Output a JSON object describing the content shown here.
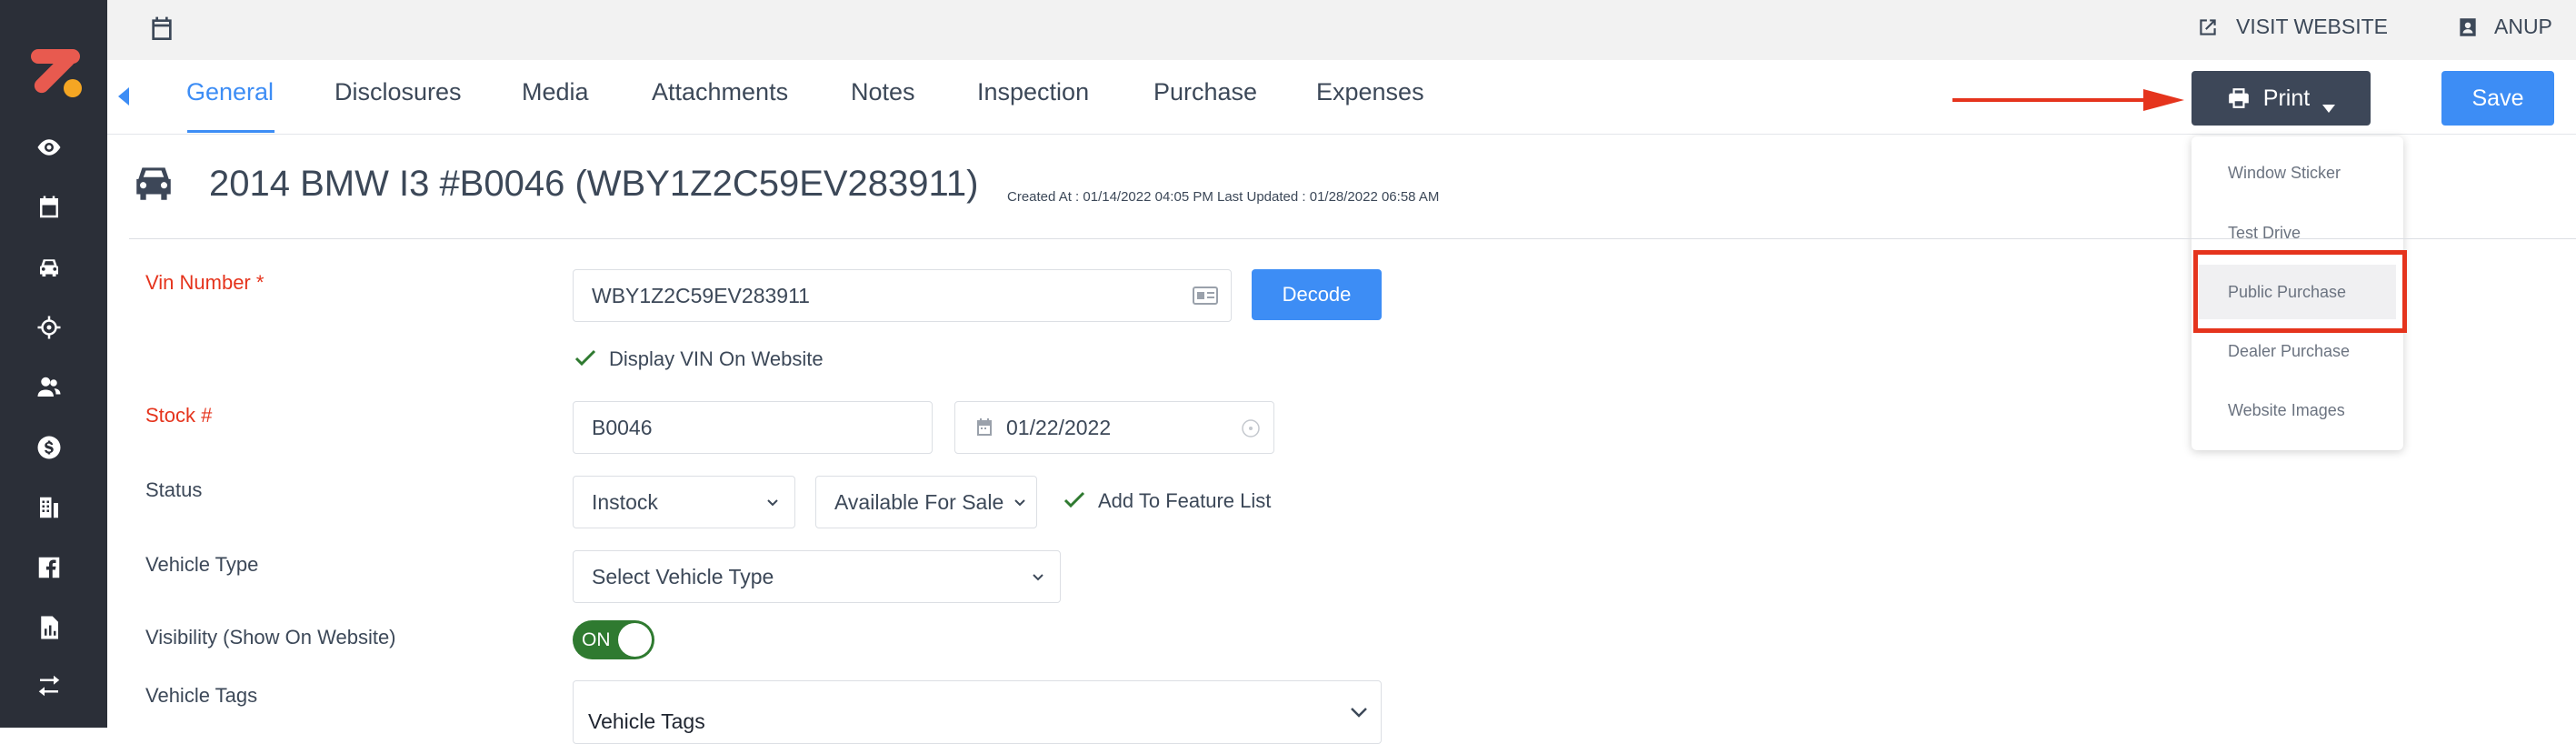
{
  "topbar": {
    "visit_website": "VISIT WEBSITE",
    "user_name": "ANUP"
  },
  "tabs": [
    {
      "label": "General",
      "active": true
    },
    {
      "label": "Disclosures"
    },
    {
      "label": "Media"
    },
    {
      "label": "Attachments"
    },
    {
      "label": "Notes"
    },
    {
      "label": "Inspection"
    },
    {
      "label": "Purchase"
    },
    {
      "label": "Expenses"
    }
  ],
  "toolbar": {
    "print_label": "Print",
    "save_label": "Save"
  },
  "print_menu": {
    "items": [
      "Window Sticker",
      "Test Drive",
      "Public Purchase",
      "Dealer Purchase",
      "Website Images"
    ],
    "highlighted": "Public Purchase"
  },
  "vehicle": {
    "title": "2014 BMW I3 #B0046 (WBY1Z2C59EV283911)",
    "meta": "Created At : 01/14/2022 04:05 PM Last Updated : 01/28/2022 06:58 AM"
  },
  "form": {
    "vin_label": "Vin Number *",
    "vin_value": "WBY1Z2C59EV283911",
    "decode_label": "Decode",
    "display_vin_label": "Display VIN On Website",
    "stock_label": "Stock #",
    "stock_value": "B0046",
    "stock_date": "01/22/2022",
    "status_label": "Status",
    "status_value": "Instock",
    "availability_value": "Available For Sale",
    "feature_list_label": "Add To Feature List",
    "vehicle_type_label": "Vehicle Type",
    "vehicle_type_placeholder": "Select Vehicle Type",
    "visibility_label": "Visibility (Show On Website)",
    "visibility_toggle": "ON",
    "tags_label": "Vehicle Tags",
    "tags_placeholder": "Vehicle Tags"
  },
  "colors": {
    "sidebar": "#2b2f38",
    "accent": "#3d8df5",
    "required": "#e5341d",
    "toggle_on": "#2f7a30"
  }
}
